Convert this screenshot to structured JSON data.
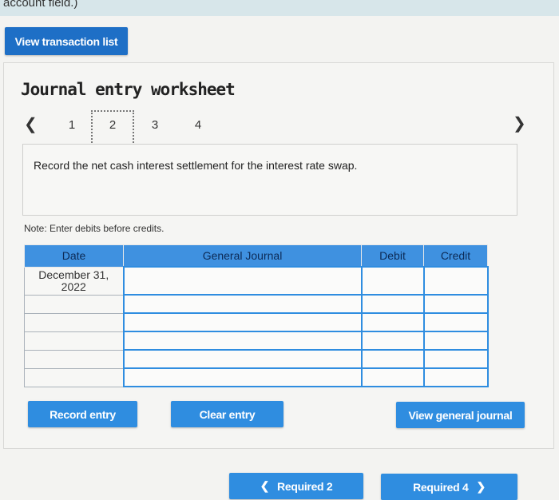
{
  "top": {
    "cut_text": "account field.)"
  },
  "header": {
    "view_transactions_label": "View transaction list"
  },
  "worksheet": {
    "title": "Journal entry worksheet",
    "prev_icon": "chevron-left-icon",
    "next_icon": "chevron-right-icon",
    "steps": [
      "1",
      "2",
      "3",
      "4"
    ],
    "active_step": "2",
    "description": "Record the net cash interest settlement for the interest rate swap.",
    "note": "Note: Enter debits before credits."
  },
  "table": {
    "headers": [
      "Date",
      "General Journal",
      "Debit",
      "Credit"
    ],
    "rows": [
      {
        "date": "December 31, 2022",
        "account": "",
        "debit": "",
        "credit": ""
      },
      {
        "date": "",
        "account": "",
        "debit": "",
        "credit": ""
      },
      {
        "date": "",
        "account": "",
        "debit": "",
        "credit": ""
      },
      {
        "date": "",
        "account": "",
        "debit": "",
        "credit": ""
      },
      {
        "date": "",
        "account": "",
        "debit": "",
        "credit": ""
      },
      {
        "date": "",
        "account": "",
        "debit": "",
        "credit": ""
      }
    ]
  },
  "actions": {
    "record": "Record entry",
    "clear": "Clear entry",
    "view_journal": "View general journal"
  },
  "footer": {
    "prev_label": "Required 2",
    "next_label": "Required 4"
  },
  "colors": {
    "button": "#2f8de0",
    "header": "#3f91e0"
  }
}
